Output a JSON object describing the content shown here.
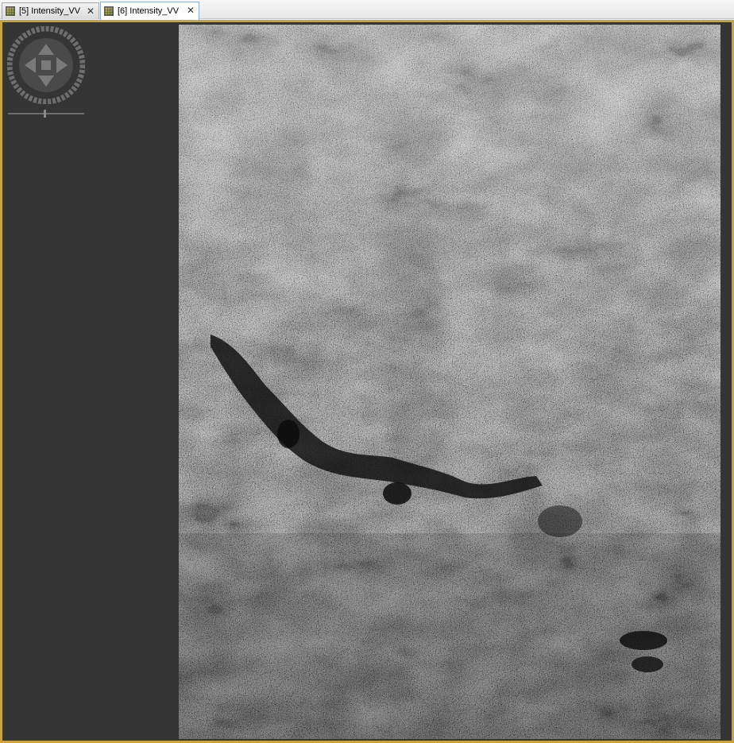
{
  "tabs": [
    {
      "label": "[5] Intensity_VV",
      "active": false,
      "close": "✕"
    },
    {
      "label": "[6] Intensity_VV",
      "active": true,
      "close": "✕"
    }
  ],
  "viewer": {
    "accent_color": "#c8a43a",
    "background_color": "#353535",
    "navigation_icon": "pan-navigation-icon",
    "zoom_icon": "zoom-slider-icon"
  }
}
